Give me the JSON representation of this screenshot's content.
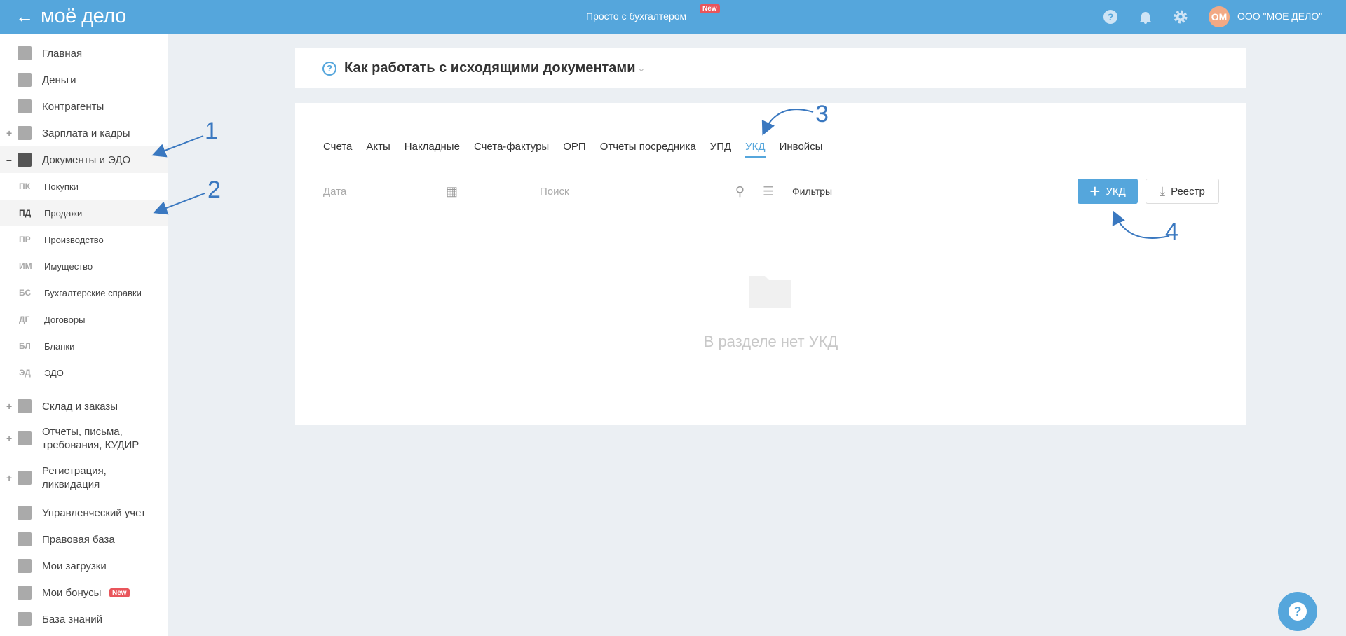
{
  "header": {
    "logo": "моё дело",
    "promo": "Просто с бухгалтером",
    "promo_badge": "New",
    "avatar": "ОМ",
    "org": "ООО \"МОЕ ДЕЛО\""
  },
  "sidebar": {
    "items": [
      {
        "label": "Главная",
        "icon": "home-icon"
      },
      {
        "label": "Деньги",
        "icon": "money-icon"
      },
      {
        "label": "Контрагенты",
        "icon": "contractors-icon"
      },
      {
        "label": "Зарплата и кадры",
        "icon": "wallet-icon",
        "toggle": "+"
      },
      {
        "label": "Документы и ЭДО",
        "icon": "folder-icon",
        "toggle": "–"
      }
    ],
    "subitems": [
      {
        "abbr": "ПК",
        "label": "Покупки"
      },
      {
        "abbr": "ПД",
        "label": "Продажи"
      },
      {
        "abbr": "ПР",
        "label": "Производство"
      },
      {
        "abbr": "ИМ",
        "label": "Имущество"
      },
      {
        "abbr": "БС",
        "label": "Бухгалтерские справки"
      },
      {
        "abbr": "ДГ",
        "label": "Договоры"
      },
      {
        "abbr": "БЛ",
        "label": "Бланки"
      },
      {
        "abbr": "ЭД",
        "label": "ЭДО"
      }
    ],
    "items2": [
      {
        "label": "Склад и заказы",
        "toggle": "+"
      },
      {
        "label": "Отчеты, письма, требования, КУДИР",
        "toggle": "+"
      },
      {
        "label": "Регистрация, ликвидация",
        "toggle": "+"
      },
      {
        "label": "Управленческий учет"
      },
      {
        "label": "Правовая база"
      },
      {
        "label": "Мои загрузки"
      },
      {
        "label": "Мои бонусы",
        "badge": "New"
      },
      {
        "label": "База знаний"
      }
    ]
  },
  "faq": {
    "title": "Как работать с исходящими документами"
  },
  "tabs": [
    "Счета",
    "Акты",
    "Накладные",
    "Счета-фактуры",
    "ОРП",
    "Отчеты посредника",
    "УПД",
    "УКД",
    "Инвойсы"
  ],
  "filters": {
    "date_placeholder": "Дата",
    "search_placeholder": "Поиск",
    "filters_label": "Фильтры",
    "add_label": "УКД",
    "registry_label": "Реестр"
  },
  "empty": {
    "text": "В разделе нет УКД"
  },
  "annotations": [
    "1",
    "2",
    "3",
    "4"
  ],
  "colors": {
    "accent": "#55a6dc",
    "annotation": "#3a78c0",
    "badge": "#e9555b"
  }
}
